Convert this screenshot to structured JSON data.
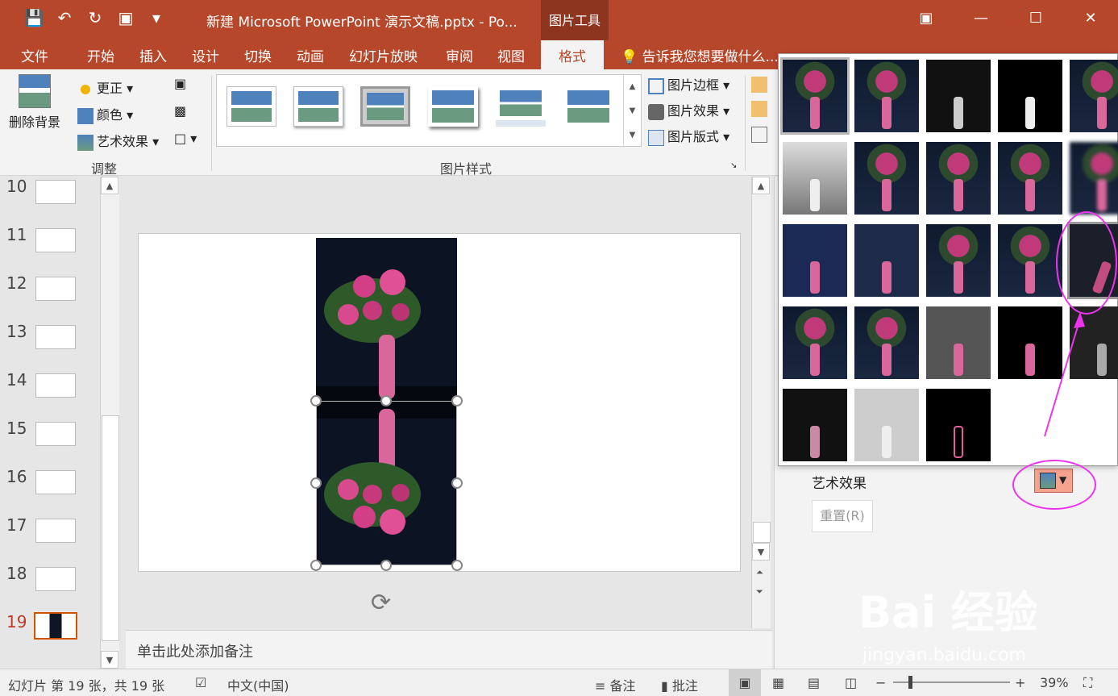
{
  "title_bar": {
    "document_title": "新建 Microsoft PowerPoint 演示文稿.pptx - Po...",
    "context_tab_group": "图片工具"
  },
  "ribbon_tabs": [
    "文件",
    "开始",
    "插入",
    "设计",
    "切换",
    "动画",
    "幻灯片放映",
    "审阅",
    "视图",
    "格式"
  ],
  "active_tab": "格式",
  "tell_me": "告诉我您想要做什么...",
  "adjust_group": {
    "remove_bg": "删除背景",
    "corrections": "更正",
    "color": "颜色",
    "artistic_effects": "艺术效果",
    "label": "调整"
  },
  "picture_styles_group": {
    "label": "图片样式",
    "border": "图片边框",
    "effects": "图片效果",
    "layout": "图片版式"
  },
  "slides": [
    {
      "num": "10"
    },
    {
      "num": "11"
    },
    {
      "num": "12"
    },
    {
      "num": "13"
    },
    {
      "num": "14"
    },
    {
      "num": "15"
    },
    {
      "num": "16"
    },
    {
      "num": "17"
    },
    {
      "num": "18"
    },
    {
      "num": "19"
    }
  ],
  "notes_placeholder": "单击此处添加备注",
  "task_pane": {
    "artistic_effects_label": "艺术效果",
    "reset_button": "重置(R)"
  },
  "status_bar": {
    "slide_info": "幻灯片 第 19 张，共 19 张",
    "language": "中文(中国)",
    "notes": "备注",
    "comments": "批注",
    "zoom": "39%"
  },
  "watermark": {
    "logo": "Bai 经验",
    "url": "jingyan.baidu.com"
  },
  "colors": {
    "accent": "#b7472a",
    "annotation": "#ee33ee"
  }
}
